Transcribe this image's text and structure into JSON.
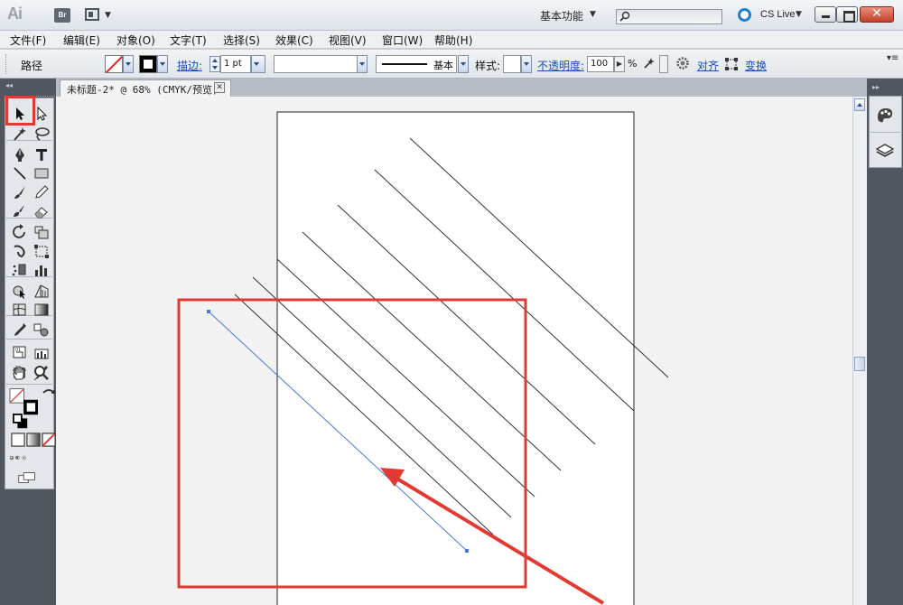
{
  "app": {
    "logo": "Ai",
    "bridge": "Br",
    "workspace": "基本功能",
    "search_placeholder": "",
    "cs_live": "CS Live"
  },
  "menu": [
    {
      "label": "文件(F)"
    },
    {
      "label": "编辑(E)"
    },
    {
      "label": "对象(O)"
    },
    {
      "label": "文字(T)"
    },
    {
      "label": "选择(S)"
    },
    {
      "label": "效果(C)"
    },
    {
      "label": "视图(V)"
    },
    {
      "label": "窗口(W)"
    },
    {
      "label": "帮助(H)"
    }
  ],
  "control": {
    "path_label": "路径",
    "stroke_label": "描边:",
    "stroke_weight": "1 pt",
    "brush_label": "基本",
    "style_label": "样式:",
    "opacity_label": "不透明度:",
    "opacity_value": "100",
    "percent": "%",
    "align_label": "对齐",
    "transform_label": "变换"
  },
  "document": {
    "tab_title": "未标题-2* @ 68% (CMYK/预览)",
    "close_glyph": "✕"
  },
  "tools": [
    "selection-tool",
    "direct-selection-tool",
    "magic-wand-tool",
    "lasso-tool",
    "pen-tool",
    "type-tool",
    "line-segment-tool",
    "rectangle-tool",
    "paintbrush-tool",
    "pencil-tool",
    "blob-brush-tool",
    "eraser-tool",
    "rotate-tool",
    "scale-tool",
    "warp-tool",
    "free-transform-tool",
    "symbol-sprayer-tool",
    "column-graph-tool",
    "shape-builder-tool",
    "perspective-grid-tool",
    "mesh-tool",
    "gradient-tool",
    "eyedropper-tool",
    "blend-tool",
    "slice-tool",
    "graph-tool",
    "artboard-tool",
    "knife-tool",
    "hand-tool",
    "zoom-tool"
  ],
  "colors": {
    "accent_red": "#e23a33",
    "selection_blue": "#4a78d8",
    "link_blue": "#1a4cc0"
  }
}
